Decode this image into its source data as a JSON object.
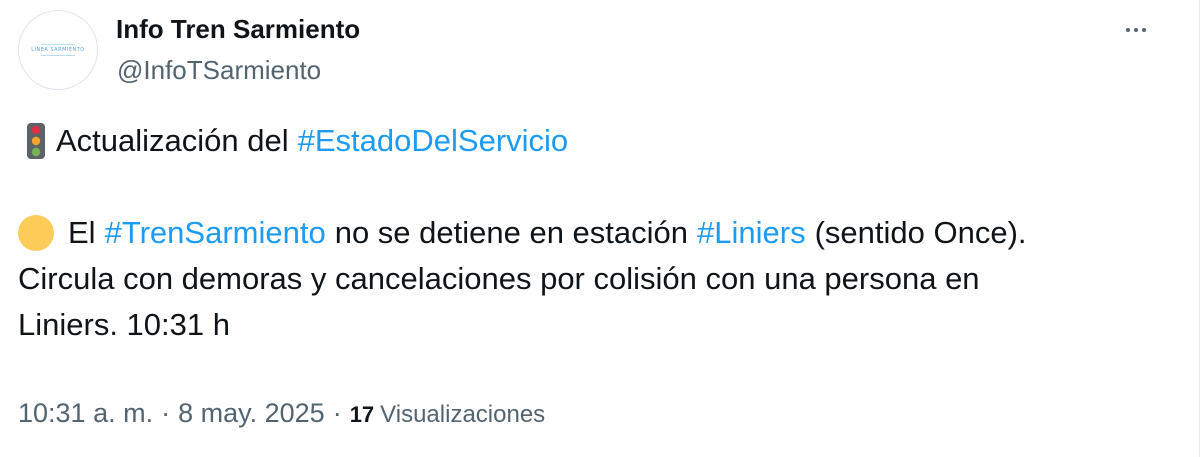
{
  "author": {
    "display_name": "Info Tren Sarmiento",
    "handle": "@InfoTSarmiento",
    "avatar_text": "LÍNEA SARMIENTO"
  },
  "menu": {
    "icon": "more-horizontal-icon"
  },
  "tweet": {
    "line1": {
      "emoji": "vertical-traffic-light-icon",
      "text": "Actualización del",
      "hashtag": "#EstadoDelServicio"
    },
    "line2": {
      "emoji": "yellow-circle-icon",
      "t1": "El",
      "hashtag1": "#TrenSarmiento",
      "t2": "no se detiene en estación",
      "hashtag2": "#Liniers",
      "t3": "(sentido Once)."
    },
    "line3": "Circula con demoras y cancelaciones por colisión con una persona en",
    "line4": "Liniers. 10:31 h"
  },
  "meta": {
    "time": "10:31 a. m.",
    "date": "8 may. 2025",
    "separator": "·",
    "views_count": "17",
    "views_label": "Visualizaciones"
  },
  "colors": {
    "text": "#0f1419",
    "secondary": "#536471",
    "link": "#1d9bf0",
    "yellow_circle": "#fdcb58"
  }
}
